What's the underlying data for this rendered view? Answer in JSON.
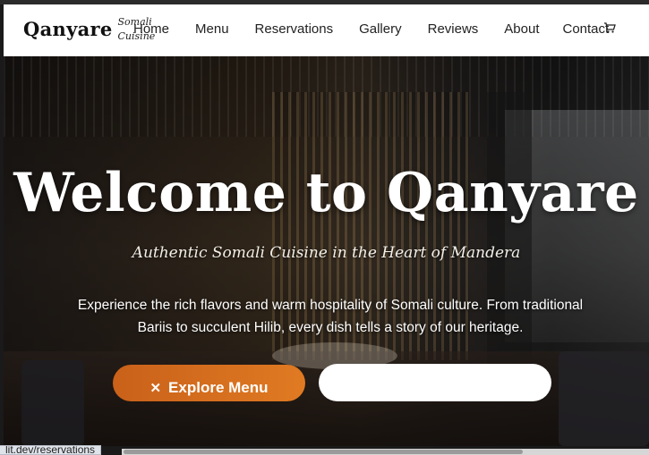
{
  "brand": {
    "name": "Qanyare",
    "sub_line1": "Somali",
    "sub_line2": "Cuisine"
  },
  "nav": {
    "items": [
      {
        "label": "Home"
      },
      {
        "label": "Menu"
      },
      {
        "label": "Reservations"
      },
      {
        "label": "Gallery"
      },
      {
        "label": "Reviews"
      },
      {
        "label": "About"
      },
      {
        "label": "Contact"
      }
    ],
    "cart_icon": "cart-icon"
  },
  "hero": {
    "title": "Welcome to Qanyare",
    "tagline": "Authentic Somali Cuisine in the Heart of Mandera",
    "description": "Experience the rich flavors and warm hospitality of Somali culture. From traditional Bariis to succulent Hilib, every dish tells a story of our heritage.",
    "explore_label": "Explore Menu",
    "explore_icon": "utensils-icon",
    "reserve_label": ""
  },
  "status": {
    "url": "lit.dev/reservations"
  },
  "colors": {
    "accent": "#e07a22",
    "accent_dark": "#c9611a",
    "nav_bg": "#ffffff",
    "text_light": "#ffffff"
  }
}
